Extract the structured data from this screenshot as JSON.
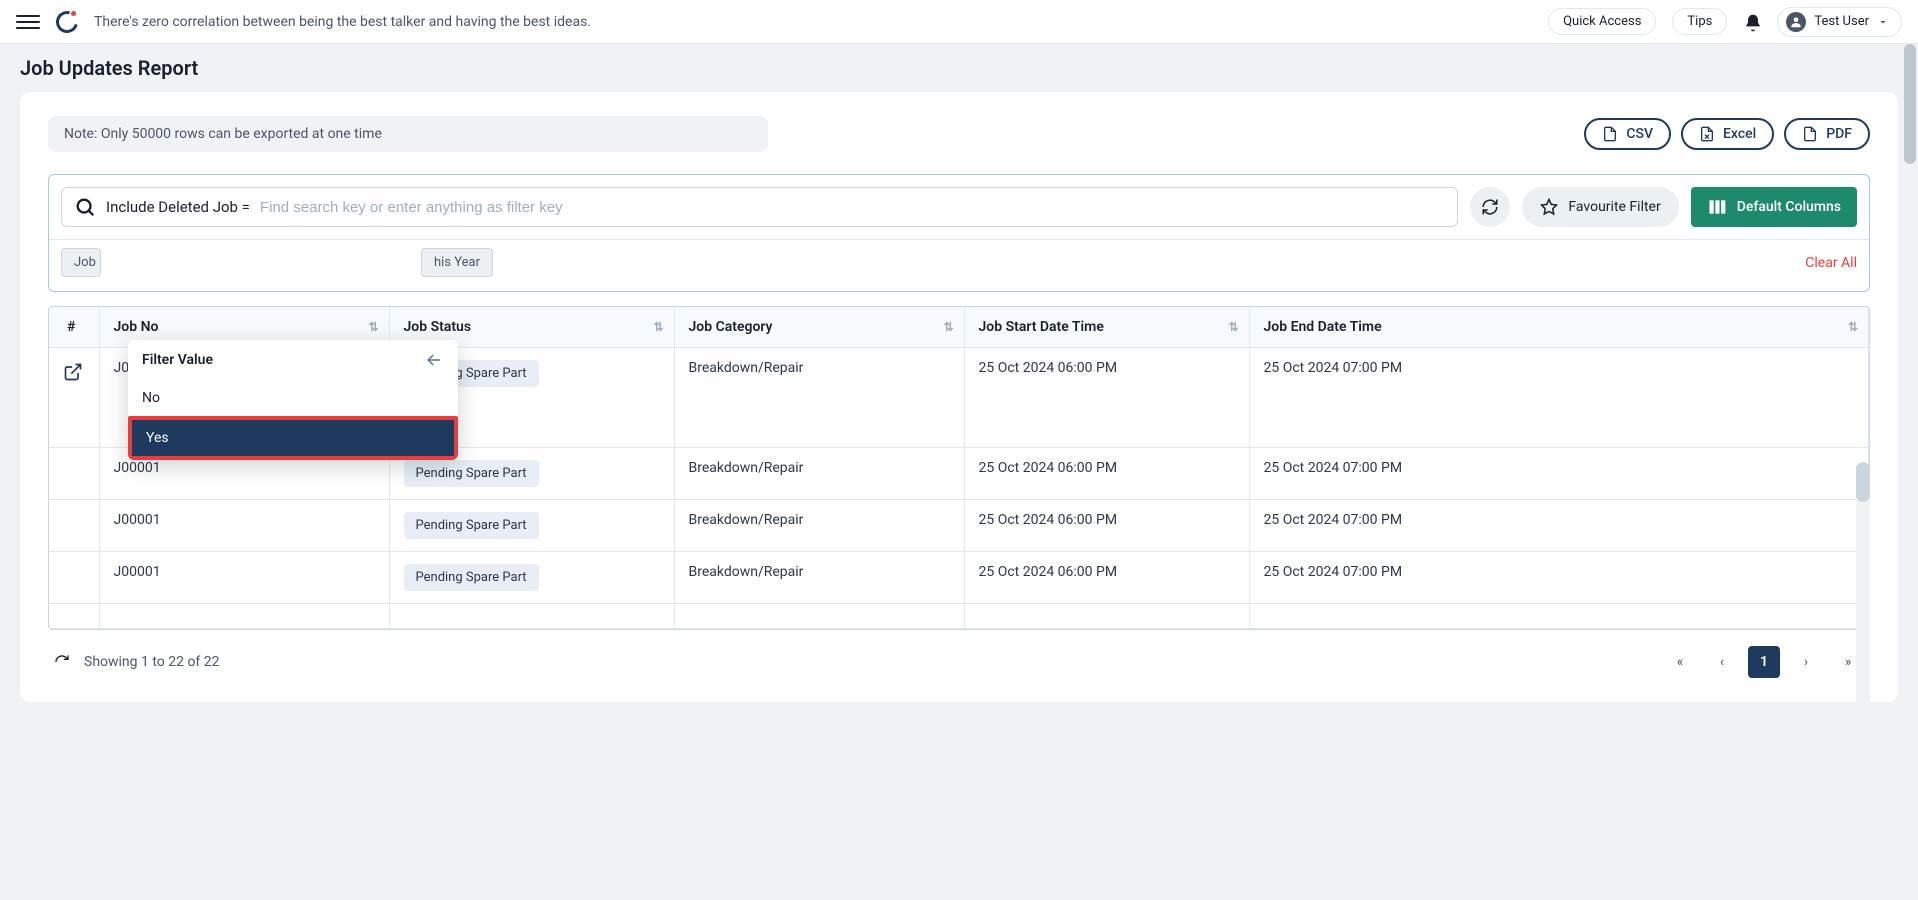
{
  "header": {
    "tagline": "There's zero correlation between being the best talker and having the best ideas.",
    "quick_access": "Quick Access",
    "tips": "Tips",
    "user_name": "Test User"
  },
  "page": {
    "title": "Job Updates Report",
    "note": "Note: Only 50000 rows can be exported at one time",
    "export": {
      "csv": "CSV",
      "excel": "Excel",
      "pdf": "PDF"
    },
    "search": {
      "prefix": "Include Deleted Job  =",
      "placeholder": "Find search key or enter anything as filter key"
    },
    "favourite_filter": "Favourite Filter",
    "default_columns": "Default Columns",
    "chips": {
      "job_partial": "Job",
      "this_year": "his Year"
    },
    "clear_all": "Clear All",
    "popover": {
      "title": "Filter Value",
      "options": {
        "no": "No",
        "yes": "Yes"
      }
    }
  },
  "table": {
    "headers": {
      "hash": "#",
      "job_no": "Job No",
      "job_status": "Job Status",
      "job_category": "Job Category",
      "job_start": "Job Start Date Time",
      "job_end": "Job End Date Time"
    },
    "rows": [
      {
        "job_no": "J00001",
        "status": "Pending Spare Part",
        "category": "Breakdown/Repair",
        "start": "25 Oct 2024 06:00 PM",
        "end": "25 Oct 2024 07:00 PM"
      },
      {
        "job_no": "J00001",
        "status": "Pending Spare Part",
        "category": "Breakdown/Repair",
        "start": "25 Oct 2024 06:00 PM",
        "end": "25 Oct 2024 07:00 PM"
      },
      {
        "job_no": "J00001",
        "status": "Pending Spare Part",
        "category": "Breakdown/Repair",
        "start": "25 Oct 2024 06:00 PM",
        "end": "25 Oct 2024 07:00 PM"
      },
      {
        "job_no": "J00001",
        "status": "Pending Spare Part",
        "category": "Breakdown/Repair",
        "start": "25 Oct 2024 06:00 PM",
        "end": "25 Oct 2024 07:00 PM"
      }
    ]
  },
  "footer": {
    "showing": "Showing 1 to 22 of 22",
    "page": "1"
  }
}
